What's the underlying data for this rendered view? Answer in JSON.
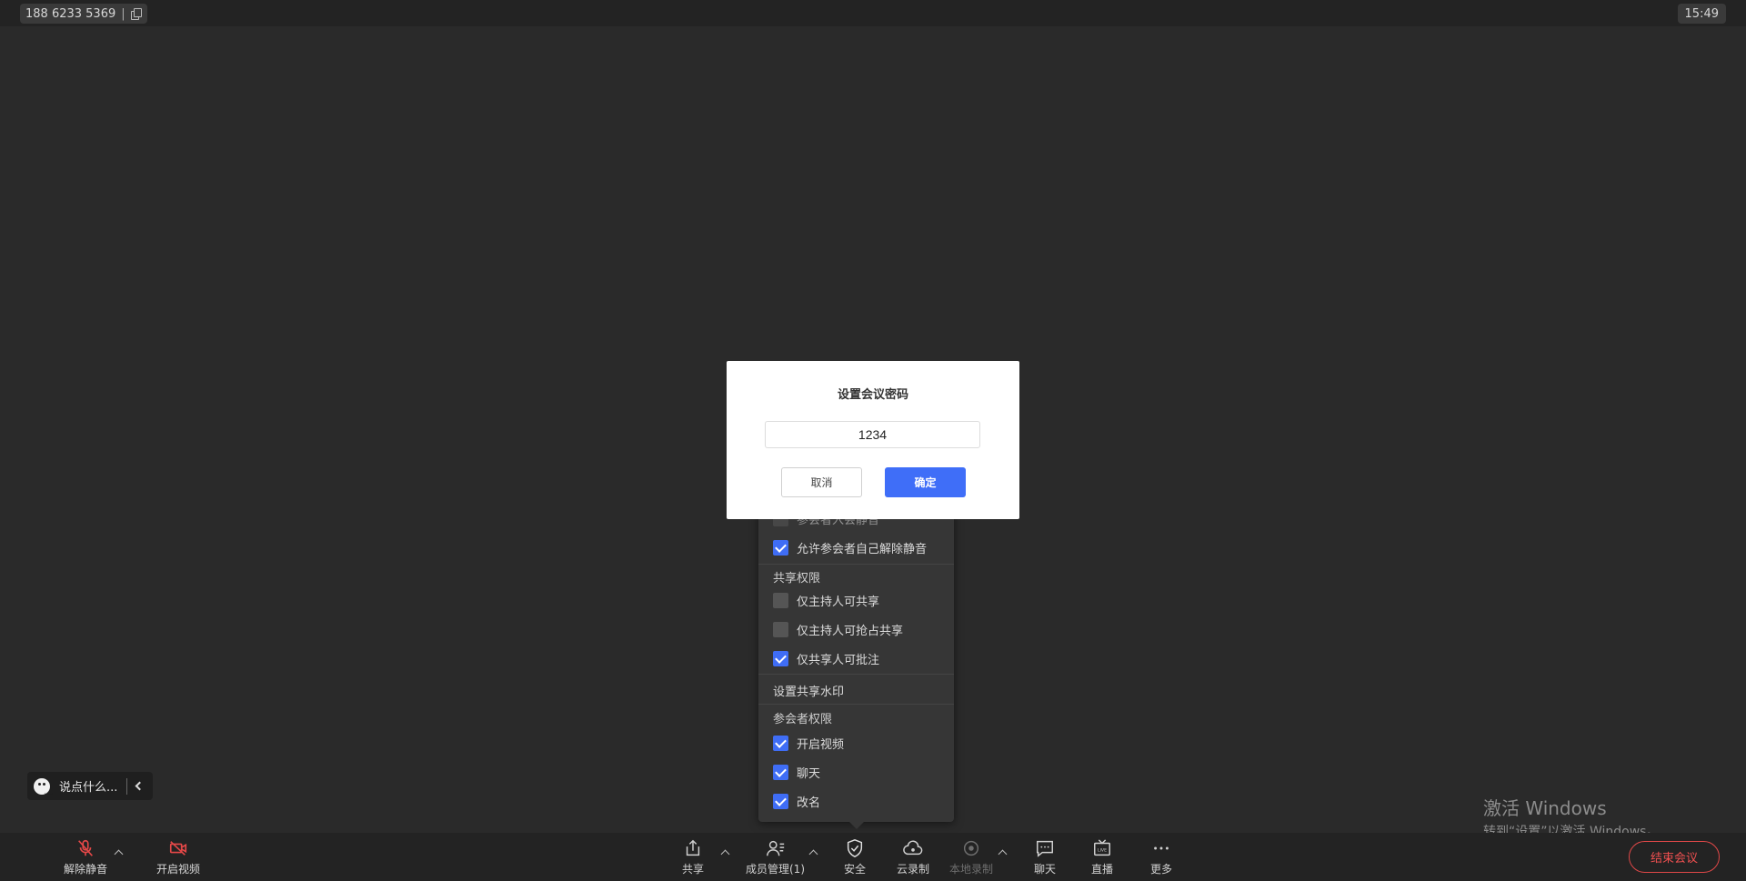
{
  "topbar": {
    "meeting_id": "188 6233 5369",
    "time": "15:49"
  },
  "security_menu": {
    "partial_option": "参会者入会静音",
    "allow_unmute": "允许参会者自己解除静音",
    "share_section": "共享权限",
    "share_host_only": "仅主持人可共享",
    "share_host_grab": "仅主持人可抢占共享",
    "share_annotate": "仅共享人可批注",
    "watermark": "设置共享水印",
    "attendee_section": "参会者权限",
    "enable_video": "开启视频",
    "chat": "聊天",
    "rename": "改名"
  },
  "modal": {
    "title": "设置会议密码",
    "password_value": "1234",
    "cancel_label": "取消",
    "ok_label": "确定"
  },
  "chat_input": {
    "placeholder": "说点什么..."
  },
  "watermark": {
    "line1": "激活 Windows",
    "line2": "转到“设置”以激活 Windows。"
  },
  "toolbar": {
    "unmute": "解除静音",
    "start_video": "开启视频",
    "share": "共享",
    "members": "成员管理(1)",
    "security": "安全",
    "cloud_record": "云录制",
    "local_record": "本地录制",
    "chat": "聊天",
    "live": "直播",
    "more": "更多",
    "end_meeting": "结束会议"
  },
  "colors": {
    "accent": "#3f6ef8",
    "danger": "#e04848"
  }
}
